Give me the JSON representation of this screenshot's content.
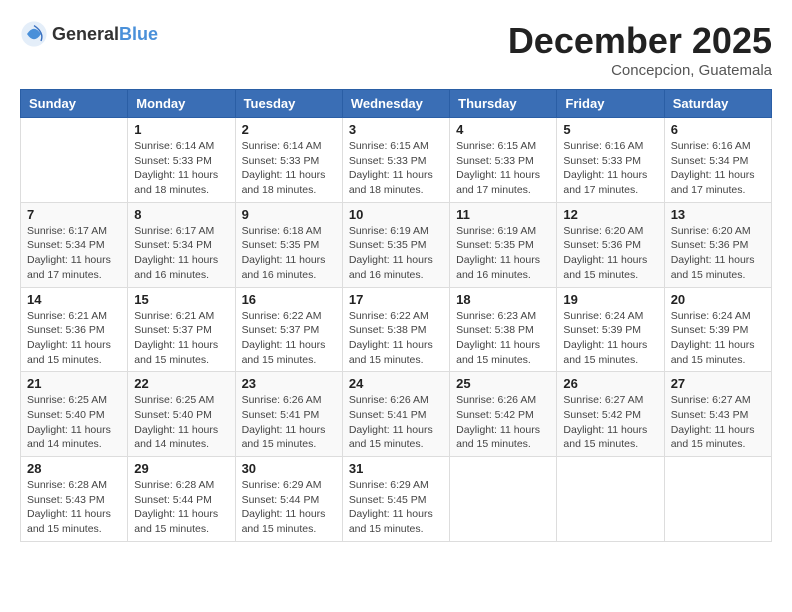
{
  "header": {
    "logo_general": "General",
    "logo_blue": "Blue",
    "month_year": "December 2025",
    "location": "Concepcion, Guatemala"
  },
  "calendar": {
    "days_of_week": [
      "Sunday",
      "Monday",
      "Tuesday",
      "Wednesday",
      "Thursday",
      "Friday",
      "Saturday"
    ],
    "weeks": [
      [
        {
          "day": "",
          "info": ""
        },
        {
          "day": "1",
          "info": "Sunrise: 6:14 AM\nSunset: 5:33 PM\nDaylight: 11 hours\nand 18 minutes."
        },
        {
          "day": "2",
          "info": "Sunrise: 6:14 AM\nSunset: 5:33 PM\nDaylight: 11 hours\nand 18 minutes."
        },
        {
          "day": "3",
          "info": "Sunrise: 6:15 AM\nSunset: 5:33 PM\nDaylight: 11 hours\nand 18 minutes."
        },
        {
          "day": "4",
          "info": "Sunrise: 6:15 AM\nSunset: 5:33 PM\nDaylight: 11 hours\nand 17 minutes."
        },
        {
          "day": "5",
          "info": "Sunrise: 6:16 AM\nSunset: 5:33 PM\nDaylight: 11 hours\nand 17 minutes."
        },
        {
          "day": "6",
          "info": "Sunrise: 6:16 AM\nSunset: 5:34 PM\nDaylight: 11 hours\nand 17 minutes."
        }
      ],
      [
        {
          "day": "7",
          "info": "Sunrise: 6:17 AM\nSunset: 5:34 PM\nDaylight: 11 hours\nand 17 minutes."
        },
        {
          "day": "8",
          "info": "Sunrise: 6:17 AM\nSunset: 5:34 PM\nDaylight: 11 hours\nand 16 minutes."
        },
        {
          "day": "9",
          "info": "Sunrise: 6:18 AM\nSunset: 5:35 PM\nDaylight: 11 hours\nand 16 minutes."
        },
        {
          "day": "10",
          "info": "Sunrise: 6:19 AM\nSunset: 5:35 PM\nDaylight: 11 hours\nand 16 minutes."
        },
        {
          "day": "11",
          "info": "Sunrise: 6:19 AM\nSunset: 5:35 PM\nDaylight: 11 hours\nand 16 minutes."
        },
        {
          "day": "12",
          "info": "Sunrise: 6:20 AM\nSunset: 5:36 PM\nDaylight: 11 hours\nand 15 minutes."
        },
        {
          "day": "13",
          "info": "Sunrise: 6:20 AM\nSunset: 5:36 PM\nDaylight: 11 hours\nand 15 minutes."
        }
      ],
      [
        {
          "day": "14",
          "info": "Sunrise: 6:21 AM\nSunset: 5:36 PM\nDaylight: 11 hours\nand 15 minutes."
        },
        {
          "day": "15",
          "info": "Sunrise: 6:21 AM\nSunset: 5:37 PM\nDaylight: 11 hours\nand 15 minutes."
        },
        {
          "day": "16",
          "info": "Sunrise: 6:22 AM\nSunset: 5:37 PM\nDaylight: 11 hours\nand 15 minutes."
        },
        {
          "day": "17",
          "info": "Sunrise: 6:22 AM\nSunset: 5:38 PM\nDaylight: 11 hours\nand 15 minutes."
        },
        {
          "day": "18",
          "info": "Sunrise: 6:23 AM\nSunset: 5:38 PM\nDaylight: 11 hours\nand 15 minutes."
        },
        {
          "day": "19",
          "info": "Sunrise: 6:24 AM\nSunset: 5:39 PM\nDaylight: 11 hours\nand 15 minutes."
        },
        {
          "day": "20",
          "info": "Sunrise: 6:24 AM\nSunset: 5:39 PM\nDaylight: 11 hours\nand 15 minutes."
        }
      ],
      [
        {
          "day": "21",
          "info": "Sunrise: 6:25 AM\nSunset: 5:40 PM\nDaylight: 11 hours\nand 14 minutes."
        },
        {
          "day": "22",
          "info": "Sunrise: 6:25 AM\nSunset: 5:40 PM\nDaylight: 11 hours\nand 14 minutes."
        },
        {
          "day": "23",
          "info": "Sunrise: 6:26 AM\nSunset: 5:41 PM\nDaylight: 11 hours\nand 15 minutes."
        },
        {
          "day": "24",
          "info": "Sunrise: 6:26 AM\nSunset: 5:41 PM\nDaylight: 11 hours\nand 15 minutes."
        },
        {
          "day": "25",
          "info": "Sunrise: 6:26 AM\nSunset: 5:42 PM\nDaylight: 11 hours\nand 15 minutes."
        },
        {
          "day": "26",
          "info": "Sunrise: 6:27 AM\nSunset: 5:42 PM\nDaylight: 11 hours\nand 15 minutes."
        },
        {
          "day": "27",
          "info": "Sunrise: 6:27 AM\nSunset: 5:43 PM\nDaylight: 11 hours\nand 15 minutes."
        }
      ],
      [
        {
          "day": "28",
          "info": "Sunrise: 6:28 AM\nSunset: 5:43 PM\nDaylight: 11 hours\nand 15 minutes."
        },
        {
          "day": "29",
          "info": "Sunrise: 6:28 AM\nSunset: 5:44 PM\nDaylight: 11 hours\nand 15 minutes."
        },
        {
          "day": "30",
          "info": "Sunrise: 6:29 AM\nSunset: 5:44 PM\nDaylight: 11 hours\nand 15 minutes."
        },
        {
          "day": "31",
          "info": "Sunrise: 6:29 AM\nSunset: 5:45 PM\nDaylight: 11 hours\nand 15 minutes."
        },
        {
          "day": "",
          "info": ""
        },
        {
          "day": "",
          "info": ""
        },
        {
          "day": "",
          "info": ""
        }
      ]
    ]
  }
}
